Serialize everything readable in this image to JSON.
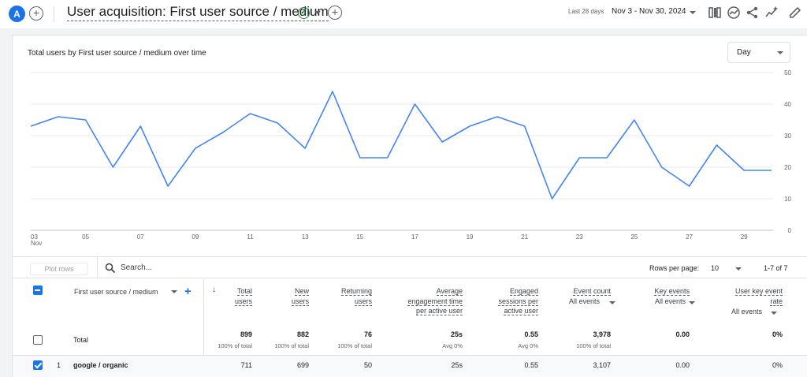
{
  "header": {
    "avatar_letter": "A",
    "add_label": "+",
    "title": "User acquisition: First user source / medium",
    "title_add_label": "+",
    "date_preset": "Last 28 days",
    "date_range": "Nov 3 - Nov 30, 2024"
  },
  "chart": {
    "granularity": "Day"
  },
  "chart_data": {
    "type": "line",
    "title": "Total users by First user source / medium over time",
    "x_label_month": "Nov",
    "x_tick_labels": [
      "03",
      "05",
      "07",
      "09",
      "11",
      "13",
      "15",
      "17",
      "19",
      "21",
      "23",
      "25",
      "27",
      "29"
    ],
    "y_tick_labels": [
      "50",
      "40",
      "30",
      "20",
      "10",
      "0"
    ],
    "ylim": [
      0,
      50
    ],
    "grid": true,
    "line_color": "#4285f4",
    "series": [
      {
        "x": [
          "Nov 3",
          "Nov 4",
          "Nov 5",
          "Nov 6",
          "Nov 7",
          "Nov 8",
          "Nov 9",
          "Nov 10",
          "Nov 11",
          "Nov 12",
          "Nov 13",
          "Nov 14",
          "Nov 15",
          "Nov 16",
          "Nov 17",
          "Nov 18",
          "Nov 19",
          "Nov 20",
          "Nov 21",
          "Nov 22",
          "Nov 23",
          "Nov 24",
          "Nov 25",
          "Nov 26",
          "Nov 27",
          "Nov 28",
          "Nov 29",
          "Nov 30"
        ],
        "values": [
          33,
          36,
          35,
          20,
          33,
          14,
          26,
          31,
          37,
          34,
          26,
          44,
          23,
          23,
          40,
          28,
          33,
          36,
          33,
          10,
          23,
          23,
          35,
          20,
          14,
          27,
          19,
          19
        ]
      }
    ]
  },
  "table": {
    "plot_rows_label": "Plot rows",
    "search_placeholder": "Search...",
    "rows_per_page_label": "Rows per page:",
    "rows_per_page_value": "10",
    "range_label": "1-7 of 7",
    "dimension_header": "First user source / medium",
    "add_dimension": "+",
    "sort_arrow": "↓",
    "columns": [
      {
        "line1": "Total",
        "line2": "users"
      },
      {
        "line1": "New",
        "line2": "users"
      },
      {
        "line1": "Returning",
        "line2": "users"
      },
      {
        "line1": "Average",
        "line2": "engagement time",
        "line3": "per active user"
      },
      {
        "line1": "Engaged",
        "line2": "sessions per",
        "line3": "active user"
      },
      {
        "line1": "Event count",
        "sub": "All events"
      },
      {
        "line1": "Key events",
        "sub": "All events"
      },
      {
        "line1": "User key event",
        "line2": "rate",
        "sub": "All events"
      }
    ],
    "totals": {
      "label": "Total",
      "values": [
        "899",
        "882",
        "76",
        "25s",
        "0.55",
        "3,978",
        "0.00",
        "0%"
      ],
      "subs": [
        "100% of total",
        "100% of total",
        "100% of total",
        "Avg 0%",
        "Avg 0%",
        "100% of total",
        "",
        ""
      ]
    },
    "rows": [
      {
        "index": "1",
        "dimension": "google / organic",
        "values": [
          "711",
          "699",
          "50",
          "25s",
          "0.55",
          "3,107",
          "0.00",
          "0%"
        ]
      }
    ]
  }
}
